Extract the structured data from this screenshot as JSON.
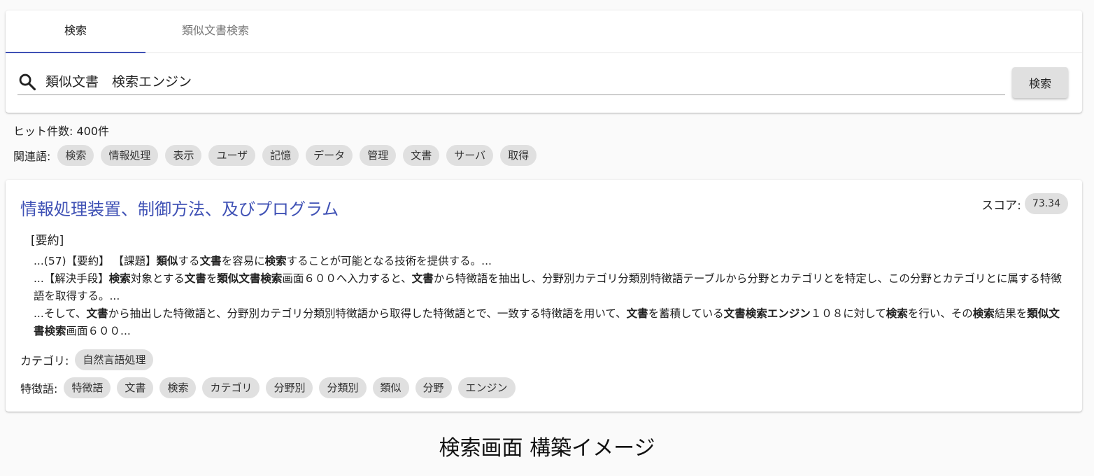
{
  "tabs": [
    {
      "label": "検索",
      "active": true
    },
    {
      "label": "類似文書検索",
      "active": false
    }
  ],
  "search": {
    "value": "類似文書　検索エンジン",
    "button_label": "検索"
  },
  "hits": {
    "label": "ヒット件数:",
    "value": "400件"
  },
  "related": {
    "label": "関連語:",
    "words": [
      "検索",
      "情報処理",
      "表示",
      "ユーザ",
      "記憶",
      "データ",
      "管理",
      "文書",
      "サーバ",
      "取得"
    ]
  },
  "result": {
    "title": "情報処理装置、制御方法、及びプログラム",
    "score_label": "スコア:",
    "score": "73.34",
    "summary_heading": "[要約]",
    "summary_paragraphs": [
      [
        {
          "t": "...(57)【要約】 【課題】",
          "b": false
        },
        {
          "t": "類似",
          "b": true
        },
        {
          "t": "する",
          "b": false
        },
        {
          "t": "文書",
          "b": true
        },
        {
          "t": "を容易に",
          "b": false
        },
        {
          "t": "検索",
          "b": true
        },
        {
          "t": "することが可能となる技術を提供する。...",
          "b": false
        }
      ],
      [
        {
          "t": "...【解決手段】",
          "b": false
        },
        {
          "t": "検索",
          "b": true
        },
        {
          "t": "対象とする",
          "b": false
        },
        {
          "t": "文書",
          "b": true
        },
        {
          "t": "を",
          "b": false
        },
        {
          "t": "類似文書検索",
          "b": true
        },
        {
          "t": "画面６００へ入力すると、",
          "b": false
        },
        {
          "t": "文書",
          "b": true
        },
        {
          "t": "から特徴語を抽出し、分野別カテゴリ分類別特徴語テーブルから分野とカテゴリとを特定し、この分野とカテゴリとに属する特徴語を取得する。...",
          "b": false
        }
      ],
      [
        {
          "t": "...そして、",
          "b": false
        },
        {
          "t": "文書",
          "b": true
        },
        {
          "t": "から抽出した特徴語と、分野別カテゴリ分類別特徴語から取得した特徴語とで、一致する特徴語を用いて、",
          "b": false
        },
        {
          "t": "文書",
          "b": true
        },
        {
          "t": "を蓄積している",
          "b": false
        },
        {
          "t": "文書検索エンジン",
          "b": true
        },
        {
          "t": "１０８に対して",
          "b": false
        },
        {
          "t": "検索",
          "b": true
        },
        {
          "t": "を行い、その",
          "b": false
        },
        {
          "t": "検索",
          "b": true
        },
        {
          "t": "結果を",
          "b": false
        },
        {
          "t": "類似文書検索",
          "b": true
        },
        {
          "t": "画面６００...",
          "b": false
        }
      ]
    ],
    "category_label": "カテゴリ:",
    "categories": [
      "自然言語処理"
    ],
    "feature_label": "特徴語:",
    "features": [
      "特徴語",
      "文書",
      "検索",
      "カテゴリ",
      "分野別",
      "分類別",
      "類似",
      "分野",
      "エンジン"
    ]
  },
  "caption": "検索画面 構築イメージ",
  "colors": {
    "accent": "#3f51b5",
    "chip": "#e0e0e0",
    "background": "#fafafa"
  },
  "icons": {
    "search": "magnifier-icon"
  }
}
